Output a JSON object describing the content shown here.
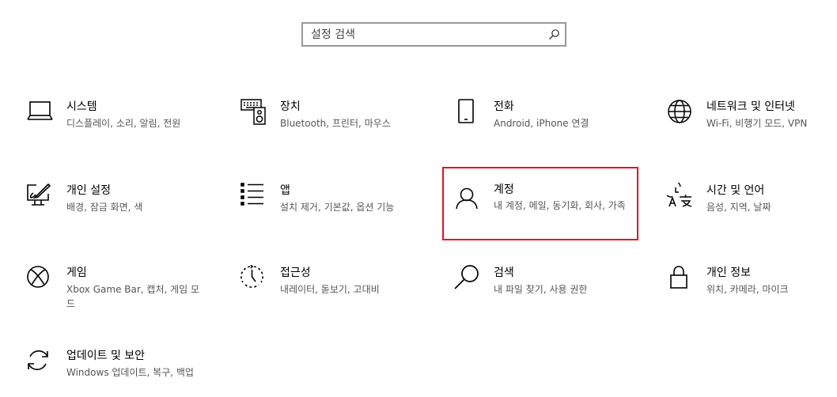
{
  "search": {
    "placeholder": "설정 검색",
    "icon": "search-icon"
  },
  "selected_tile": "accounts",
  "accent_color": "#e81123",
  "tiles": [
    {
      "id": "system",
      "icon": "laptop-icon",
      "title": "시스템",
      "desc": "디스플레이, 소리, 알림, 전원"
    },
    {
      "id": "devices",
      "icon": "keyboard-speaker-icon",
      "title": "장치",
      "desc": "Bluetooth, 프린터, 마우스"
    },
    {
      "id": "phone",
      "icon": "phone-icon",
      "title": "전화",
      "desc": "Android, iPhone 연결"
    },
    {
      "id": "network",
      "icon": "globe-icon",
      "title": "네트워크 및 인터넷",
      "desc": "Wi-Fi, 비행기 모드, VPN"
    },
    {
      "id": "personalization",
      "icon": "paint-screen-icon",
      "title": "개인 설정",
      "desc": "배경, 잠금 화면, 색"
    },
    {
      "id": "apps",
      "icon": "app-list-icon",
      "title": "앱",
      "desc": "설치 제거, 기본값, 옵션 기능"
    },
    {
      "id": "accounts",
      "icon": "person-icon",
      "title": "계정",
      "desc": "내 계정, 메일, 동기화, 회사, 가족"
    },
    {
      "id": "time-language",
      "icon": "language-icon",
      "title": "시간 및 언어",
      "desc": "음성, 지역, 날짜"
    },
    {
      "id": "gaming",
      "icon": "xbox-icon",
      "title": "게임",
      "desc": "Xbox Game Bar, 캡처, 게임 모드"
    },
    {
      "id": "ease-of-access",
      "icon": "ease-of-access-icon",
      "title": "접근성",
      "desc": "내레이터, 돋보기, 고대비"
    },
    {
      "id": "search",
      "icon": "magnifier-icon",
      "title": "검색",
      "desc": "내 파일 찾기, 사용 권한"
    },
    {
      "id": "privacy",
      "icon": "lock-icon",
      "title": "개인 정보",
      "desc": "위치, 카메라, 마이크"
    },
    {
      "id": "update-security",
      "icon": "sync-icon",
      "title": "업데이트 및 보안",
      "desc": "Windows 업데이트, 복구, 백업"
    }
  ]
}
